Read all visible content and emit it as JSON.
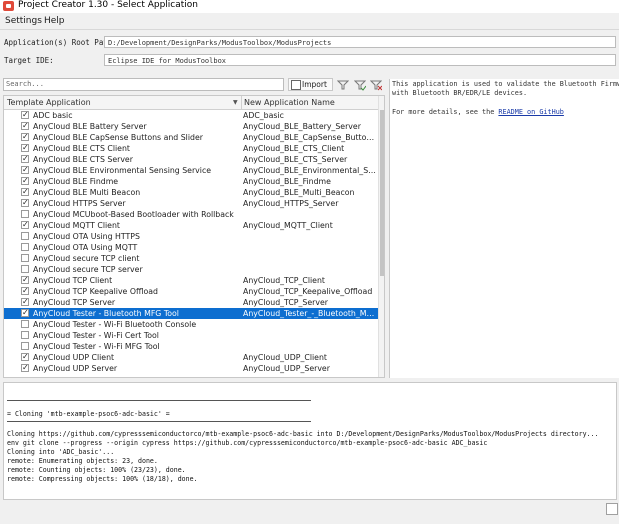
{
  "window": {
    "title": "Project Creator 1.30 - Select Application"
  },
  "menu": [
    "Settings",
    "Help"
  ],
  "fields": {
    "root_path_label": "Application(s) Root Path:",
    "root_path_value": "D:/Development/DesignParks/ModusToolbox/ModusProjects",
    "target_ide_label": "Target IDE:",
    "target_ide_value": "Eclipse IDE for ModusToolbox"
  },
  "toolbar": {
    "search_placeholder": "Search...",
    "import_label": "Import"
  },
  "table": {
    "col_template": "Template Application",
    "col_new_name": "New Application Name",
    "rows": [
      {
        "name": "ADC basic",
        "app": "ADC_basic",
        "checked": true
      },
      {
        "name": "AnyCloud BLE Battery Server",
        "app": "AnyCloud_BLE_Battery_Server",
        "checked": true
      },
      {
        "name": "AnyCloud BLE CapSense Buttons and Slider",
        "app": "AnyCloud_BLE_CapSense_Buttons...",
        "checked": true
      },
      {
        "name": "AnyCloud BLE CTS Client",
        "app": "AnyCloud_BLE_CTS_Client",
        "checked": true
      },
      {
        "name": "AnyCloud BLE CTS Server",
        "app": "AnyCloud_BLE_CTS_Server",
        "checked": true
      },
      {
        "name": "AnyCloud BLE Environmental Sensing Service",
        "app": "AnyCloud_BLE_Environmental_Se...",
        "checked": true
      },
      {
        "name": "AnyCloud BLE Findme",
        "app": "AnyCloud_BLE_Findme",
        "checked": true
      },
      {
        "name": "AnyCloud BLE Multi Beacon",
        "app": "AnyCloud_BLE_Multi_Beacon",
        "checked": true
      },
      {
        "name": "AnyCloud HTTPS Server",
        "app": "AnyCloud_HTTPS_Server",
        "checked": true
      },
      {
        "name": "AnyCloud MCUboot-Based Bootloader with Rollback",
        "app": "",
        "checked": false
      },
      {
        "name": "AnyCloud MQTT Client",
        "app": "AnyCloud_MQTT_Client",
        "checked": true
      },
      {
        "name": "AnyCloud OTA Using HTTPS",
        "app": "",
        "checked": false
      },
      {
        "name": "AnyCloud OTA Using MQTT",
        "app": "",
        "checked": false
      },
      {
        "name": "AnyCloud secure TCP client",
        "app": "",
        "checked": false
      },
      {
        "name": "AnyCloud secure TCP server",
        "app": "",
        "checked": false
      },
      {
        "name": "AnyCloud TCP Client",
        "app": "AnyCloud_TCP_Client",
        "checked": true
      },
      {
        "name": "AnyCloud TCP Keepalive Offload",
        "app": "AnyCloud_TCP_Keepalive_Offload",
        "checked": true
      },
      {
        "name": "AnyCloud TCP Server",
        "app": "AnyCloud_TCP_Server",
        "checked": true
      },
      {
        "name": "AnyCloud Tester - Bluetooth MFG Tool",
        "app": "AnyCloud_Tester_-_Bluetooth_MF...",
        "checked": true,
        "selected": true
      },
      {
        "name": "AnyCloud Tester - Wi-Fi Bluetooth Console",
        "app": "",
        "checked": false
      },
      {
        "name": "AnyCloud Tester - Wi-Fi Cert Tool",
        "app": "",
        "checked": false
      },
      {
        "name": "AnyCloud Tester - Wi-Fi MFG Tool",
        "app": "",
        "checked": false
      },
      {
        "name": "AnyCloud UDP Client",
        "app": "AnyCloud_UDP_Client",
        "checked": true
      },
      {
        "name": "AnyCloud UDP Server",
        "app": "AnyCloud_UDP_Server",
        "checked": true
      }
    ]
  },
  "description": {
    "line1": "This application is used to validate the Bluetooth Firmware",
    "line2": "with Bluetooth BR/EDR/LE devices.",
    "more_prefix": "For more details, see the ",
    "readme_link": "README on GitHub"
  },
  "console": {
    "cloning_header": "= Cloning 'mtb-example-psoc6-adc-basic' =",
    "lines": [
      "Cloning https://github.com/cypresssemiconductorco/mtb-example-psoc6-adc-basic into D:/Development/DesignParks/ModusToolbox/ModusProjects directory...",
      "env git clone --progress --origin cypress https://github.com/cypresssemiconductorco/mtb-example-psoc6-adc-basic ADC_basic",
      "Cloning into 'ADC_basic'...",
      "remote: Enumerating objects: 23, done.",
      "remote: Counting objects: 100% (23/23), done.",
      "remote: Compressing objects: 100% (18/18), done."
    ]
  }
}
